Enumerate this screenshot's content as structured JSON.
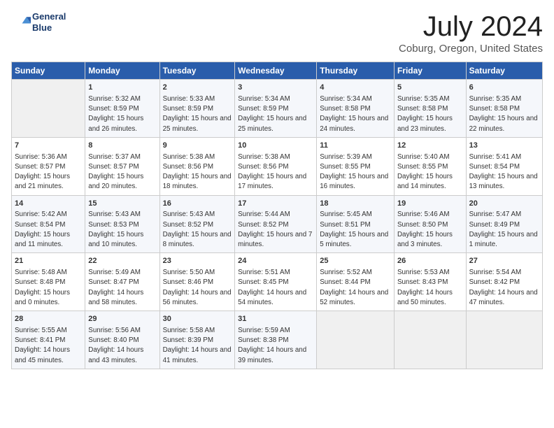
{
  "header": {
    "logo_line1": "General",
    "logo_line2": "Blue",
    "month": "July 2024",
    "location": "Coburg, Oregon, United States"
  },
  "weekdays": [
    "Sunday",
    "Monday",
    "Tuesday",
    "Wednesday",
    "Thursday",
    "Friday",
    "Saturday"
  ],
  "weeks": [
    [
      {
        "empty": true
      },
      {
        "day": "1",
        "rise": "5:32 AM",
        "set": "8:59 PM",
        "hours": "15 hours and 26 minutes"
      },
      {
        "day": "2",
        "rise": "5:33 AM",
        "set": "8:59 PM",
        "hours": "15 hours and 25 minutes"
      },
      {
        "day": "3",
        "rise": "5:34 AM",
        "set": "8:59 PM",
        "hours": "15 hours and 25 minutes"
      },
      {
        "day": "4",
        "rise": "5:34 AM",
        "set": "8:58 PM",
        "hours": "15 hours and 24 minutes"
      },
      {
        "day": "5",
        "rise": "5:35 AM",
        "set": "8:58 PM",
        "hours": "15 hours and 23 minutes"
      },
      {
        "day": "6",
        "rise": "5:35 AM",
        "set": "8:58 PM",
        "hours": "15 hours and 22 minutes"
      }
    ],
    [
      {
        "day": "7",
        "rise": "5:36 AM",
        "set": "8:57 PM",
        "hours": "15 hours and 21 minutes"
      },
      {
        "day": "8",
        "rise": "5:37 AM",
        "set": "8:57 PM",
        "hours": "15 hours and 20 minutes"
      },
      {
        "day": "9",
        "rise": "5:38 AM",
        "set": "8:56 PM",
        "hours": "15 hours and 18 minutes"
      },
      {
        "day": "10",
        "rise": "5:38 AM",
        "set": "8:56 PM",
        "hours": "15 hours and 17 minutes"
      },
      {
        "day": "11",
        "rise": "5:39 AM",
        "set": "8:55 PM",
        "hours": "15 hours and 16 minutes"
      },
      {
        "day": "12",
        "rise": "5:40 AM",
        "set": "8:55 PM",
        "hours": "15 hours and 14 minutes"
      },
      {
        "day": "13",
        "rise": "5:41 AM",
        "set": "8:54 PM",
        "hours": "15 hours and 13 minutes"
      }
    ],
    [
      {
        "day": "14",
        "rise": "5:42 AM",
        "set": "8:54 PM",
        "hours": "15 hours and 11 minutes"
      },
      {
        "day": "15",
        "rise": "5:43 AM",
        "set": "8:53 PM",
        "hours": "15 hours and 10 minutes"
      },
      {
        "day": "16",
        "rise": "5:43 AM",
        "set": "8:52 PM",
        "hours": "15 hours and 8 minutes"
      },
      {
        "day": "17",
        "rise": "5:44 AM",
        "set": "8:52 PM",
        "hours": "15 hours and 7 minutes"
      },
      {
        "day": "18",
        "rise": "5:45 AM",
        "set": "8:51 PM",
        "hours": "15 hours and 5 minutes"
      },
      {
        "day": "19",
        "rise": "5:46 AM",
        "set": "8:50 PM",
        "hours": "15 hours and 3 minutes"
      },
      {
        "day": "20",
        "rise": "5:47 AM",
        "set": "8:49 PM",
        "hours": "15 hours and 1 minute"
      }
    ],
    [
      {
        "day": "21",
        "rise": "5:48 AM",
        "set": "8:48 PM",
        "hours": "15 hours and 0 minutes"
      },
      {
        "day": "22",
        "rise": "5:49 AM",
        "set": "8:47 PM",
        "hours": "14 hours and 58 minutes"
      },
      {
        "day": "23",
        "rise": "5:50 AM",
        "set": "8:46 PM",
        "hours": "14 hours and 56 minutes"
      },
      {
        "day": "24",
        "rise": "5:51 AM",
        "set": "8:45 PM",
        "hours": "14 hours and 54 minutes"
      },
      {
        "day": "25",
        "rise": "5:52 AM",
        "set": "8:44 PM",
        "hours": "14 hours and 52 minutes"
      },
      {
        "day": "26",
        "rise": "5:53 AM",
        "set": "8:43 PM",
        "hours": "14 hours and 50 minutes"
      },
      {
        "day": "27",
        "rise": "5:54 AM",
        "set": "8:42 PM",
        "hours": "14 hours and 47 minutes"
      }
    ],
    [
      {
        "day": "28",
        "rise": "5:55 AM",
        "set": "8:41 PM",
        "hours": "14 hours and 45 minutes"
      },
      {
        "day": "29",
        "rise": "5:56 AM",
        "set": "8:40 PM",
        "hours": "14 hours and 43 minutes"
      },
      {
        "day": "30",
        "rise": "5:58 AM",
        "set": "8:39 PM",
        "hours": "14 hours and 41 minutes"
      },
      {
        "day": "31",
        "rise": "5:59 AM",
        "set": "8:38 PM",
        "hours": "14 hours and 39 minutes"
      },
      {
        "empty": true
      },
      {
        "empty": true
      },
      {
        "empty": true
      }
    ]
  ]
}
